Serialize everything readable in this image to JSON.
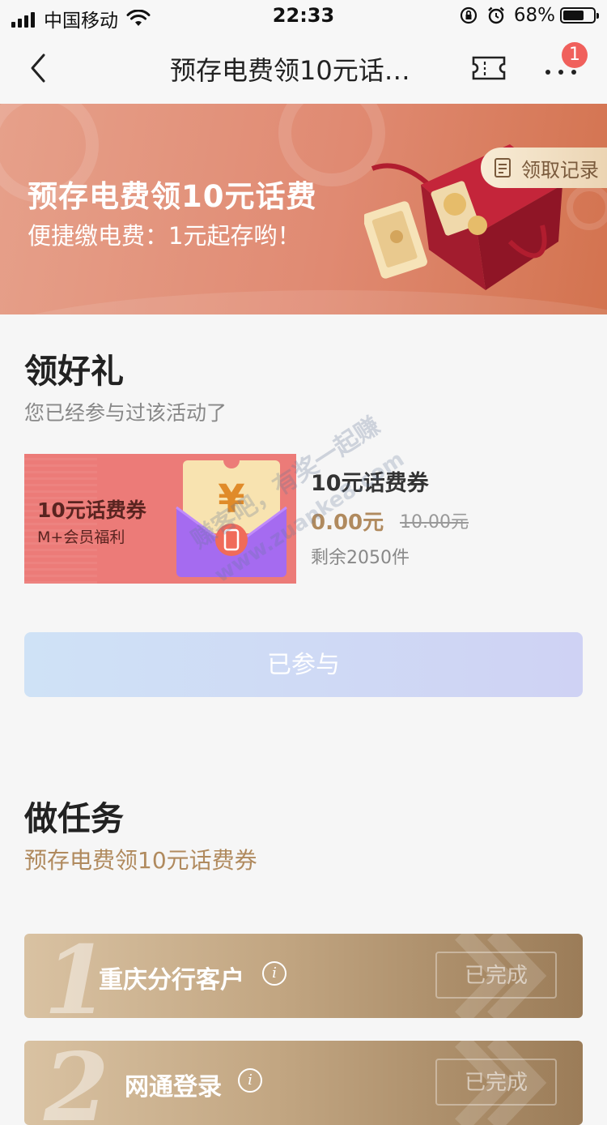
{
  "status_bar": {
    "carrier": "中国移动",
    "time": "22:33",
    "battery": "68%",
    "battery_level": 0.68
  },
  "nav": {
    "title": "预存电费领10元话…",
    "badge_count": "1",
    "icons": [
      "chevron-left-icon",
      "ticket-icon",
      "more-icon"
    ]
  },
  "banner": {
    "title": "预存电费领10元话费",
    "subtitle": "便捷缴电费：1元起存哟！",
    "records_label": "领取记录"
  },
  "gift_section": {
    "title": "领好礼",
    "subtitle": "您已经参与过该活动了",
    "coupon": {
      "card_name": "10元话费券",
      "card_tag": "M+会员福利",
      "product_name": "10元话费券",
      "price_now": "0.00元",
      "price_old": "10.00元",
      "stock": "剩余2050件"
    },
    "joined_button": "已参与"
  },
  "task_section": {
    "title": "做任务",
    "subtitle": "预存电费领10元话费券",
    "tasks": [
      {
        "number": "1",
        "label": "重庆分行客户",
        "status": "已完成"
      },
      {
        "number": "2",
        "label": "网通登录",
        "status": "已完成"
      }
    ]
  },
  "watermark": {
    "line1": "赚客吧，有奖一起赚",
    "line2": "www.zuanke8.com"
  },
  "colors": {
    "banner": "#e08a72",
    "coupon_card": "#ec7b78",
    "price_accent": "#b08a5e",
    "badge": "#f0605c",
    "task_gold": "#c2a682"
  }
}
